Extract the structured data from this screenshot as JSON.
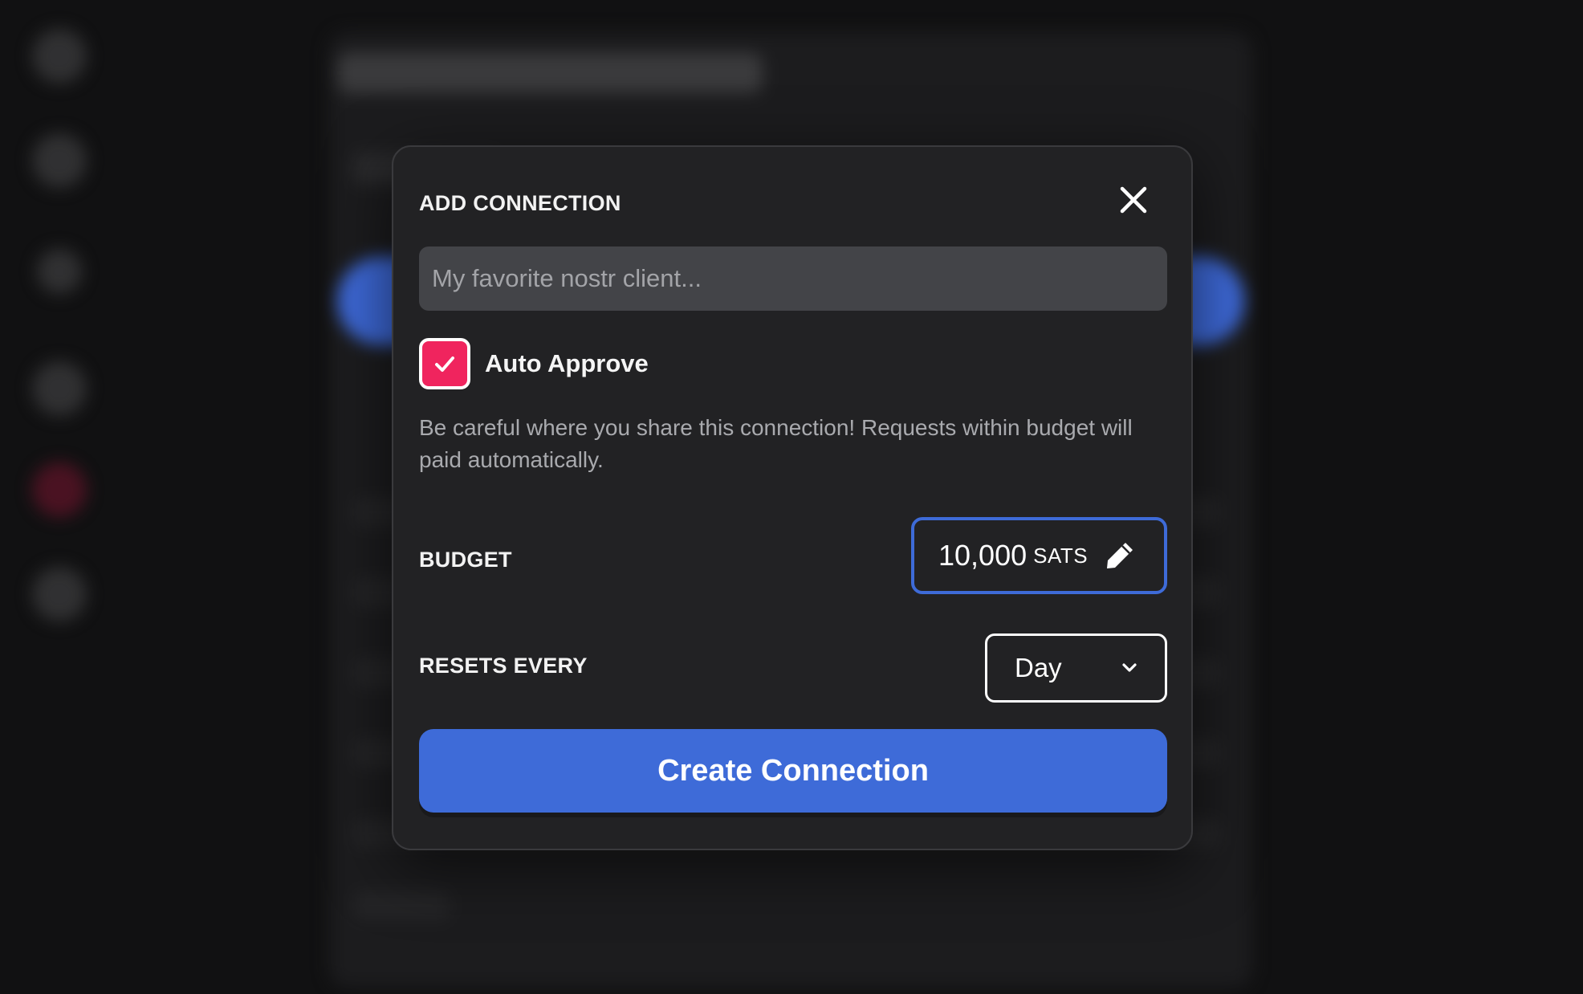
{
  "modal": {
    "title": "ADD CONNECTION",
    "name_input": {
      "placeholder": "My favorite nostr client...",
      "value": ""
    },
    "auto_approve": {
      "label": "Auto Approve",
      "checked": true
    },
    "warning": "Be careful where you share this connection! Requests within budget will paid automatically.",
    "budget": {
      "label": "BUDGET",
      "value": "10,000",
      "unit": "SATS"
    },
    "resets_every": {
      "label": "RESETS EVERY",
      "selected": "Day"
    },
    "create_button": "Create Connection"
  },
  "colors": {
    "accent": "#3e6bd8",
    "checkbox": "#f0245e",
    "modal_bg": "#222224"
  },
  "icons": [
    "close-icon",
    "check-icon",
    "pencil-icon",
    "chevron-down-icon"
  ]
}
